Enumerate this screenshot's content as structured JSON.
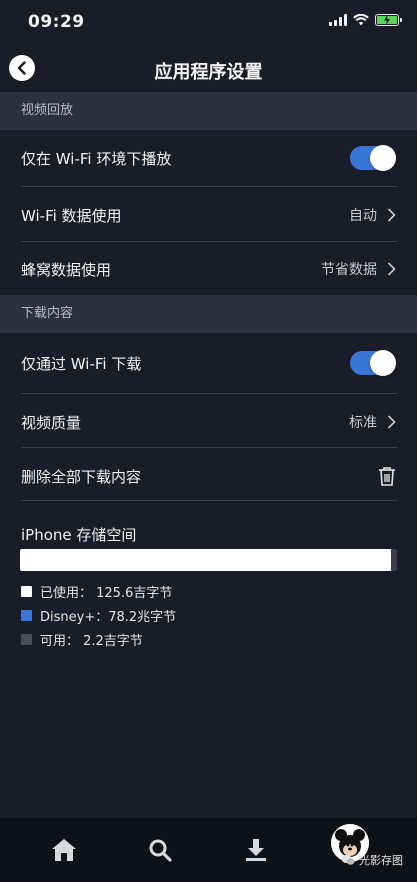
{
  "status_bar": {
    "time": "09:29"
  },
  "header": {
    "title": "应用程序设置"
  },
  "sections": {
    "playback": {
      "title": "视频回放",
      "wifi_only_label": "仅在 Wi-Fi 环境下播放",
      "wifi_only_on": true,
      "wifi_data_label": "Wi-Fi 数据使用",
      "wifi_data_value": "自动",
      "cellular_data_label": "蜂窝数据使用",
      "cellular_data_value": "节省数据"
    },
    "downloads": {
      "title": "下载内容",
      "wifi_only_label": "仅通过 Wi-Fi 下载",
      "wifi_only_on": true,
      "quality_label": "视频质量",
      "quality_value": "标准",
      "delete_all_label": "删除全部下载内容"
    }
  },
  "storage": {
    "title": "iPhone 存储空间",
    "used_fraction": 0.985,
    "disney_fraction": 0.0,
    "legend": [
      {
        "label": "已使用：  125.6吉字节",
        "color": "#ffffff"
      },
      {
        "label": "Disney+：78.2兆字节",
        "color": "#3a76d6"
      },
      {
        "label": "可用：  2.2吉字节",
        "color": "#4b4e5a"
      }
    ]
  },
  "tab_bar": {
    "items": [
      {
        "icon": "home-icon"
      },
      {
        "icon": "search-icon"
      },
      {
        "icon": "download-icon"
      },
      {
        "icon": "profile-avatar"
      }
    ]
  },
  "watermark": {
    "text": "光影存图"
  }
}
